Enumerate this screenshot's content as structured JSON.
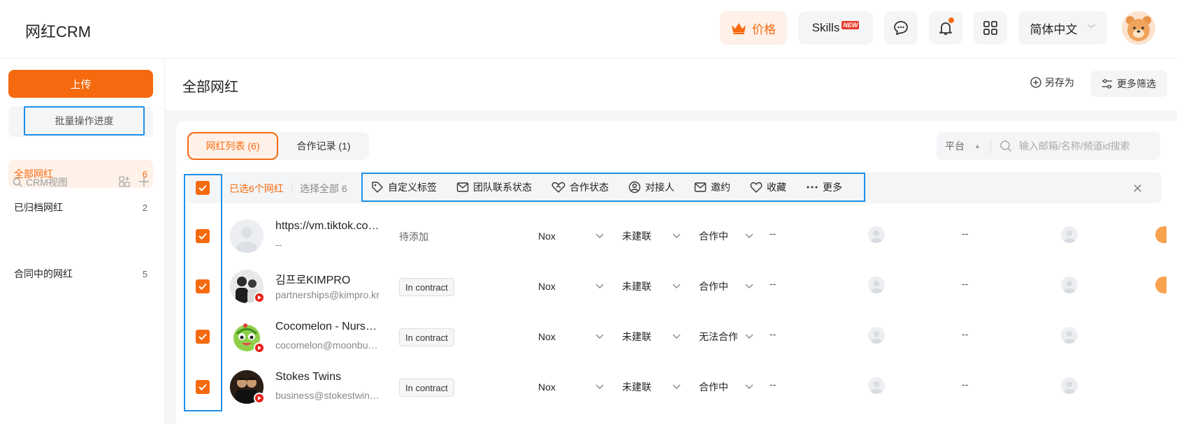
{
  "app": {
    "title": "网红CRM"
  },
  "topbar": {
    "price_label": "价格",
    "skills_label": "Skills",
    "skills_badge": "NEW",
    "language": "简体中文"
  },
  "sidebar": {
    "upload_label": "上传",
    "batch_label": "批量操作进度",
    "items": [
      {
        "label": "全部网红",
        "count": "6"
      },
      {
        "label": "已归档网红",
        "count": "2"
      }
    ],
    "crm_view_label": "CRM视图",
    "views": [
      {
        "label": "合同中的网红",
        "count": "5"
      }
    ]
  },
  "main": {
    "title": "全部网红",
    "save_as": "另存为",
    "more_filters": "更多筛选",
    "tabs": [
      {
        "label": "网红列表 (6)"
      },
      {
        "label": "合作记录 (1)"
      }
    ],
    "platform_label": "平台",
    "search_placeholder": "输入邮箱/名称/频道id搜索"
  },
  "selection": {
    "selected_text": "已选6个网红",
    "select_all": "选择全部 6",
    "actions": [
      {
        "label": "自定义标签",
        "icon": "tag-icon"
      },
      {
        "label": "团队联系状态",
        "icon": "mail-icon"
      },
      {
        "label": "合作状态",
        "icon": "handshake-icon"
      },
      {
        "label": "对接人",
        "icon": "user-icon"
      },
      {
        "label": "邀约",
        "icon": "envelope-icon"
      },
      {
        "label": "收藏",
        "icon": "heart-icon"
      },
      {
        "label": "更多",
        "icon": "dots-icon"
      }
    ]
  },
  "rows": [
    {
      "name": "https://vm.tiktok.com/ZMAbcd",
      "email": "--",
      "tag": "待添加",
      "source": "Nox",
      "contact": "未建联",
      "coop": "合作中",
      "c1": "--",
      "c2": "--"
    },
    {
      "name": "김프로KIMPRO",
      "email": "partnerships@kimpro.kr",
      "tag": "In contract",
      "source": "Nox",
      "contact": "未建联",
      "coop": "合作中",
      "c1": "--",
      "c2": "--"
    },
    {
      "name": "Cocomelon - Nursery Rhymes",
      "email": "cocomelon@moonbug.com",
      "tag": "In contract",
      "source": "Nox",
      "contact": "未建联",
      "coop": "无法合作",
      "c1": "--",
      "c2": "--"
    },
    {
      "name": "Stokes Twins",
      "email": "business@stokestwins.com",
      "tag": "In contract",
      "source": "Nox",
      "contact": "未建联",
      "coop": "合作中",
      "c1": "--",
      "c2": "--"
    }
  ],
  "colors": {
    "accent": "#f56a0f",
    "highlight": "#1e90e8"
  }
}
